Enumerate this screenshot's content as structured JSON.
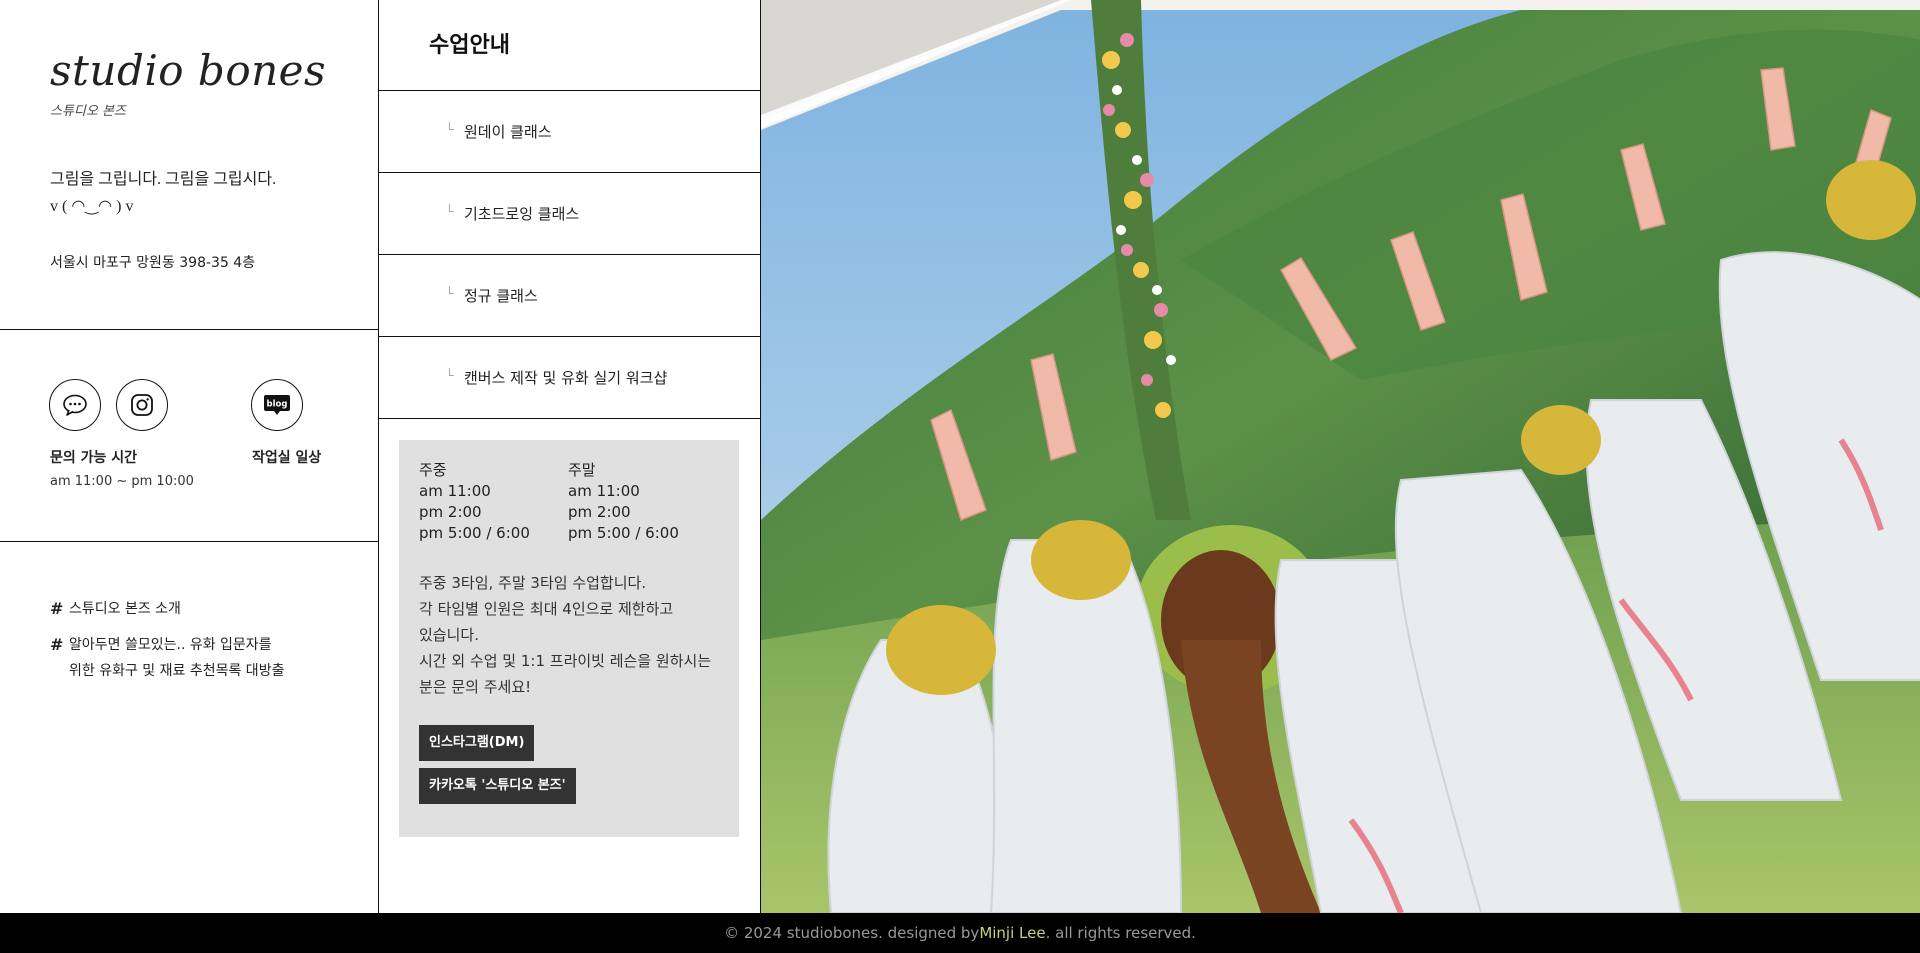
{
  "brand": {
    "name": "studio bones",
    "subtitle": "스튜디오 본즈"
  },
  "intro": {
    "line1": "그림을 그립니다. 그림을 그립시다.",
    "line2": "v ( ◠‿◠ ) v",
    "address": "서울시 마포구 망원동 398-35 4층"
  },
  "contact": {
    "hours_label": "문의 가능 시간",
    "hours_value": "am 11:00 ~ pm 10:00",
    "blog_label": "작업실 일상",
    "blog_icon_text": "blog",
    "icons": [
      "chat-bubble-icon",
      "instagram-icon",
      "blog-icon"
    ]
  },
  "links": [
    "스튜디오 본즈 소개",
    "알아두면 쓸모있는.. 유화 입문자를",
    "위한 유화구 및 재료 추천목록 대방출"
  ],
  "link_hash": "#",
  "menu": {
    "title": "수업안내",
    "bullet": "└",
    "items": [
      "원데이 클래스",
      "기초드로잉 클래스",
      "정규 클래스",
      "캔버스 제작 및 유화 실기 워크샵"
    ]
  },
  "schedule": {
    "weekday_label": "주중",
    "weekday_times": [
      "am 11:00",
      "pm 2:00",
      "pm 5:00 / 6:00"
    ],
    "weekend_label": "주말",
    "weekend_times": [
      "am 11:00",
      "pm 2:00",
      "pm 5:00 / 6:00"
    ],
    "notes": [
      "주중 3타임, 주말 3타임 수업합니다.",
      "각 타임별 인원은 최대 4인으로 제한하고",
      "있습니다.",
      "시간 외 수업 및 1:1 프라이빗 레슨을 원하시는",
      "분은 문의 주세요!"
    ],
    "dm_button": "인스타그램(DM)",
    "kakao_button": "카카오톡 '스튜디오 본즈'"
  },
  "footer": {
    "prefix": "© 2024 studiobones. designed by ",
    "author": "Minji Lee",
    "suffix": ". all rights reserved."
  },
  "colors": {
    "border": "#111111",
    "info_bg": "#e0e0e0",
    "button_bg": "#333333",
    "footer_bg": "#000000",
    "author_link": "#c8d07a"
  }
}
